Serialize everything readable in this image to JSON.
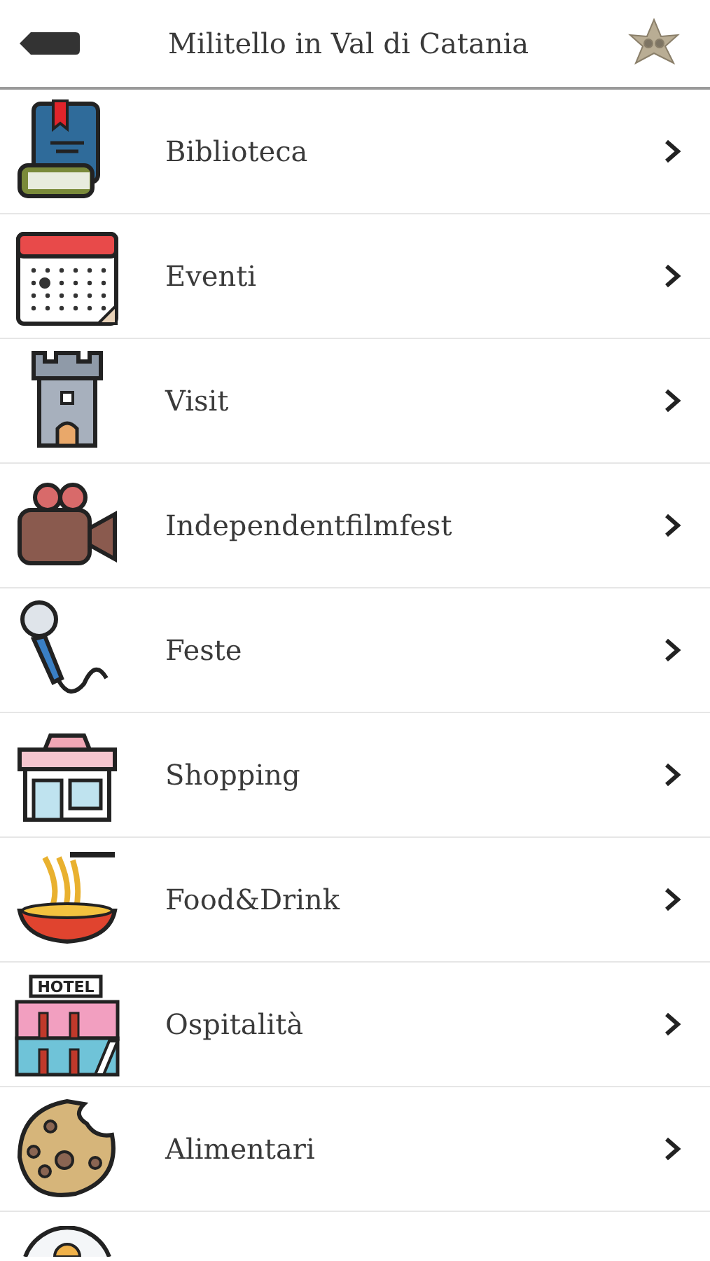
{
  "header": {
    "title": "Militello in Val di Catania"
  },
  "items": [
    {
      "label": "Biblioteca"
    },
    {
      "label": "Eventi"
    },
    {
      "label": "Visit"
    },
    {
      "label": "Independentfilmfest"
    },
    {
      "label": "Feste"
    },
    {
      "label": "Shopping"
    },
    {
      "label": "Food&Drink"
    },
    {
      "label": "Ospitalità",
      "icon_text": "HOTEL"
    },
    {
      "label": "Alimentari"
    }
  ]
}
